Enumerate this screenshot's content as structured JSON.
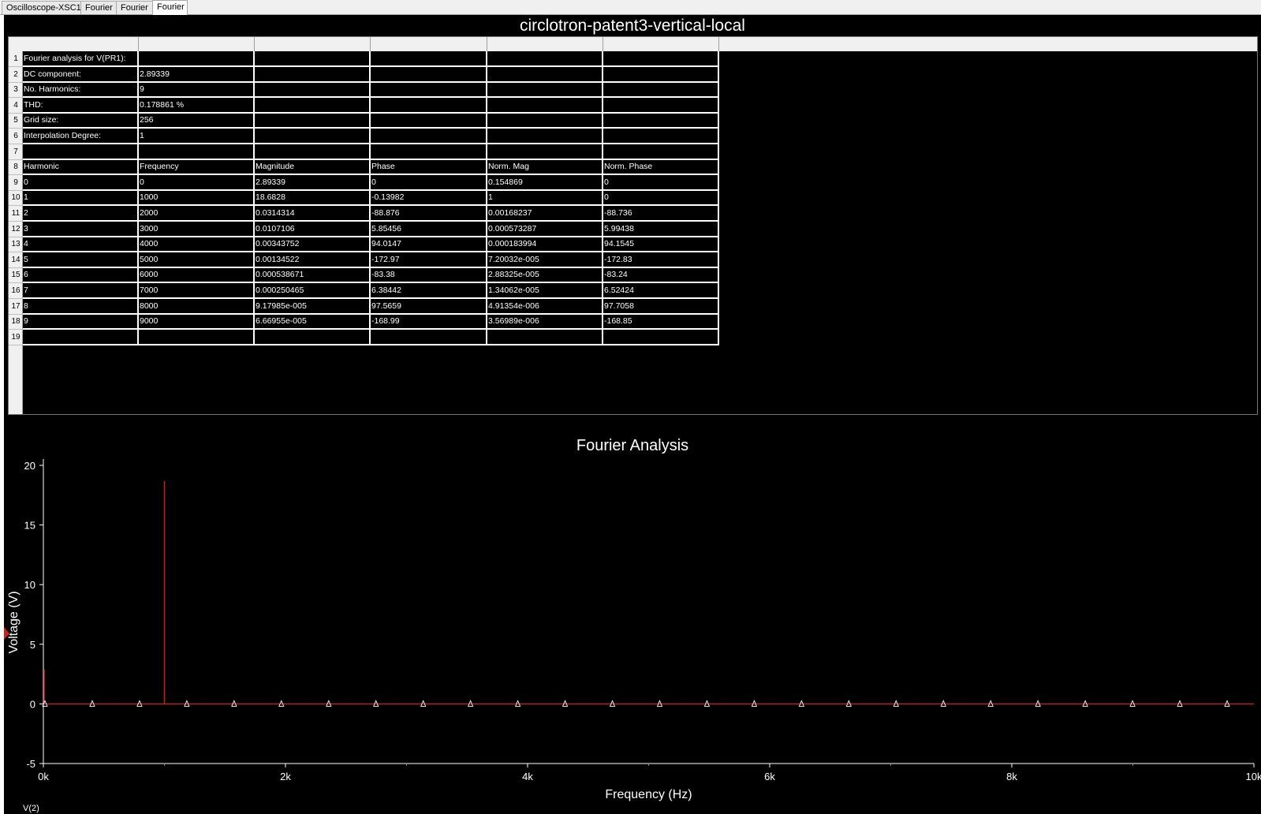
{
  "tabs": [
    {
      "label": "Oscilloscope-XSC1",
      "active": false
    },
    {
      "label": "Fourier",
      "active": false
    },
    {
      "label": "Fourier",
      "active": false
    },
    {
      "label": "Fourier",
      "active": true
    }
  ],
  "document_title": "circlotron-patent3-vertical-local",
  "grid": {
    "row_numbers": [
      "1",
      "2",
      "3",
      "4",
      "5",
      "6",
      "7",
      "8",
      "9",
      "10",
      "11",
      "12",
      "13",
      "14",
      "15",
      "16",
      "17",
      "18",
      "19"
    ],
    "rows": [
      [
        "Fourier analysis for V(PR1):",
        "",
        "",
        "",
        "",
        ""
      ],
      [
        "DC component:",
        "2.89339",
        "",
        "",
        "",
        ""
      ],
      [
        "No. Harmonics:",
        "9",
        "",
        "",
        "",
        ""
      ],
      [
        "THD:",
        "0.178861 %",
        "",
        "",
        "",
        ""
      ],
      [
        "Grid size:",
        "256",
        "",
        "",
        "",
        ""
      ],
      [
        "Interpolation Degree:",
        "1",
        "",
        "",
        "",
        ""
      ],
      [
        "",
        "",
        "",
        "",
        "",
        ""
      ],
      [
        "Harmonic",
        "Frequency",
        "Magnitude",
        "Phase",
        "Norm. Mag",
        "Norm. Phase"
      ],
      [
        "0",
        "0",
        "2.89339",
        "0",
        "0.154869",
        "0"
      ],
      [
        "1",
        "1000",
        "18.6828",
        "-0.13982",
        "1",
        "0"
      ],
      [
        "2",
        "2000",
        "0.0314314",
        "-88.876",
        "0.00168237",
        "-88.736"
      ],
      [
        "3",
        "3000",
        "0.0107106",
        "5.85456",
        "0.000573287",
        "5.99438"
      ],
      [
        "4",
        "4000",
        "0.00343752",
        "94.0147",
        "0.000183994",
        "94.1545"
      ],
      [
        "5",
        "5000",
        "0.00134522",
        "-172.97",
        "7.20032e-005",
        "-172.83"
      ],
      [
        "6",
        "6000",
        "0.000538671",
        "-83.38",
        "2.88325e-005",
        "-83.24"
      ],
      [
        "7",
        "7000",
        "0.000250465",
        "6.38442",
        "1.34062e-005",
        "6.52424"
      ],
      [
        "8",
        "8000",
        "9.17985e-005",
        "97.5659",
        "4.91354e-006",
        "97.7058"
      ],
      [
        "9",
        "9000",
        "6.66955e-005",
        "-168.99",
        "3.56989e-006",
        "-168.85"
      ],
      [
        "",
        "",
        "",
        "",
        "",
        ""
      ]
    ]
  },
  "chart_data": {
    "type": "bar",
    "title": "Fourier Analysis",
    "xlabel": "Frequency (Hz)",
    "ylabel": "Voltage (V)",
    "xlim": [
      0,
      10000
    ],
    "ylim": [
      -5,
      20
    ],
    "x_ticks": [
      {
        "value": 0,
        "label": "0k"
      },
      {
        "value": 2000,
        "label": "2k"
      },
      {
        "value": 4000,
        "label": "4k"
      },
      {
        "value": 6000,
        "label": "6k"
      },
      {
        "value": 8000,
        "label": "8k"
      },
      {
        "value": 10000,
        "label": "10k"
      }
    ],
    "y_ticks": [
      -5,
      0,
      5,
      10,
      15,
      20
    ],
    "series": [
      {
        "name": "V(2)",
        "color": "#cc1f1f",
        "x": [
          0,
          1000,
          2000,
          3000,
          4000,
          5000,
          6000,
          7000,
          8000,
          9000
        ],
        "values": [
          2.89339,
          18.6828,
          0.0314314,
          0.0107106,
          0.00343752,
          0.00134522,
          0.000538671,
          0.000250465,
          9.17985e-05,
          6.66955e-05
        ]
      }
    ],
    "marker_x": [
      0,
      390.625,
      781.25,
      1171.875,
      1562.5,
      1953.125,
      2343.75,
      2734.375,
      3125,
      3515.625,
      3906.25,
      4296.875,
      4687.5,
      5078.125,
      5468.75,
      5859.375,
      6250,
      6640.625,
      7031.25,
      7421.875,
      7812.5,
      8203.125,
      8593.75,
      8984.375,
      9375,
      9765.625
    ],
    "legend_label": "V(2)",
    "grid": false
  }
}
